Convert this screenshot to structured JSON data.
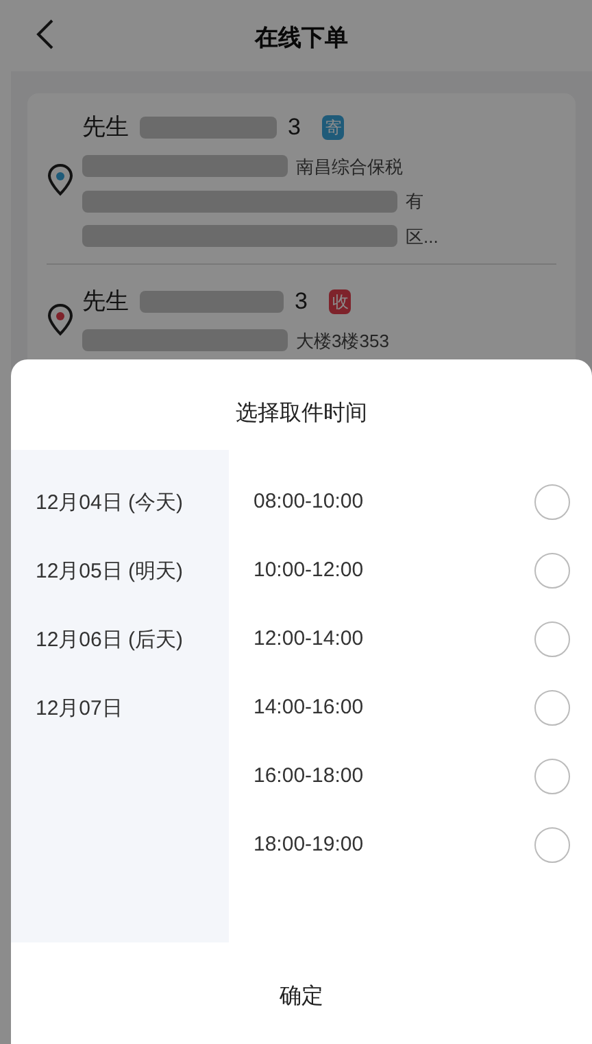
{
  "header": {
    "title": "在线下单"
  },
  "addresses": [
    {
      "kind": "sender",
      "tag": "寄",
      "name": "先生",
      "phone_tail": "3",
      "lines": [
        "南昌综合保税",
        "有",
        "区..."
      ]
    },
    {
      "kind": "receiver",
      "tag": "收",
      "name": "先生",
      "phone_tail": "3",
      "lines": [
        "大楼3楼353"
      ]
    }
  ],
  "sheet": {
    "title": "选择取件时间",
    "dates": [
      {
        "label": "12月04日 (今天)",
        "selected": false
      },
      {
        "label": "12月05日 (明天)",
        "selected": false
      },
      {
        "label": "12月06日 (后天)",
        "selected": false
      },
      {
        "label": "12月07日",
        "selected": false
      }
    ],
    "slots": [
      {
        "label": "08:00-10:00",
        "checked": false
      },
      {
        "label": "10:00-12:00",
        "checked": false
      },
      {
        "label": "12:00-14:00",
        "checked": false
      },
      {
        "label": "14:00-16:00",
        "checked": false
      },
      {
        "label": "16:00-18:00",
        "checked": false
      },
      {
        "label": "18:00-19:00",
        "checked": false
      }
    ],
    "confirm": "确定"
  }
}
